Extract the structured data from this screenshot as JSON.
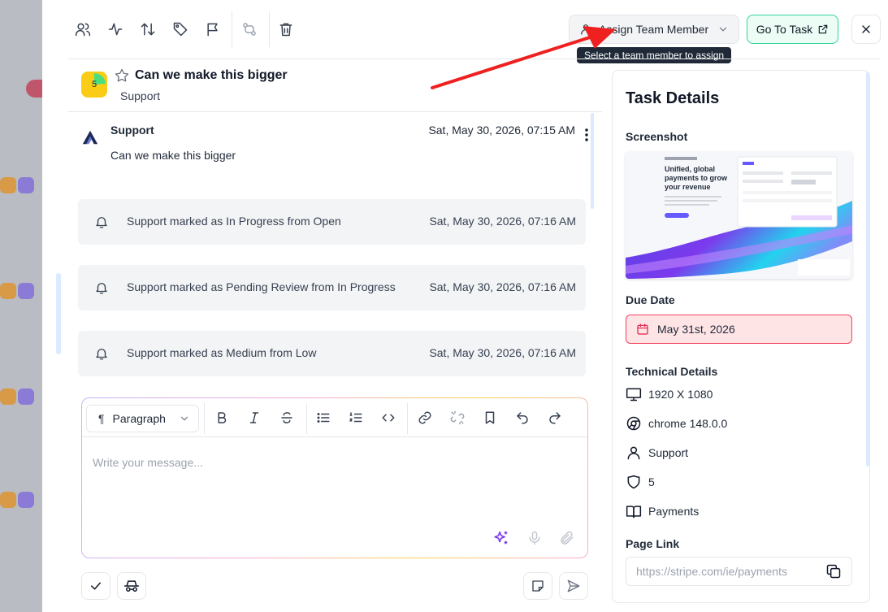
{
  "toolbar": {
    "icons": [
      "users-icon",
      "activity-icon",
      "sort-arrows-icon",
      "tag-icon",
      "flag-icon",
      "git-compare-icon",
      "trash-icon"
    ],
    "assign_label": "Assign Team Member",
    "assign_tooltip": "Select a team member to assign",
    "goto_label": "Go To Task"
  },
  "task": {
    "priority_number": "5",
    "title": "Can we make this bigger",
    "subtitle": "Support"
  },
  "feed": {
    "message": {
      "author": "Support",
      "timestamp": "Sat, May 30, 2026, 07:15 AM",
      "body": "Can we make this bigger"
    },
    "events": [
      {
        "text": "Support marked as In Progress from Open",
        "timestamp": "Sat, May 30, 2026, 07:16 AM"
      },
      {
        "text": "Support marked as Pending Review from In Progress",
        "timestamp": "Sat, May 30, 2026, 07:16 AM"
      },
      {
        "text": "Support marked as Medium from Low",
        "timestamp": "Sat, May 30, 2026, 07:16 AM"
      }
    ]
  },
  "composer": {
    "block_type": "Paragraph",
    "placeholder": "Write your message...",
    "format_buttons": [
      "bold",
      "italic",
      "strikethrough",
      "bullet-list",
      "numbered-list",
      "code",
      "link",
      "unlink",
      "bookmark",
      "undo",
      "redo"
    ]
  },
  "details": {
    "title": "Task Details",
    "screenshot_label": "Screenshot",
    "screenshot_content": {
      "headline": "Unified, global payments to grow your revenue"
    },
    "due_date_label": "Due Date",
    "due_date": "May 31st, 2026",
    "technical_label": "Technical Details",
    "resolution": "1920 X 1080",
    "browser": "chrome 148.0.0",
    "reporter": "Support",
    "priority": "5",
    "category": "Payments",
    "page_link_label": "Page Link",
    "page_link": "https://stripe.com/ie/payments"
  },
  "colors": {
    "accent_green": "#34d399",
    "due_date_border": "#f43f5e",
    "priority_yellow": "#facc15",
    "priority_green": "#22c55e",
    "annotation_red": "#ef2020"
  }
}
